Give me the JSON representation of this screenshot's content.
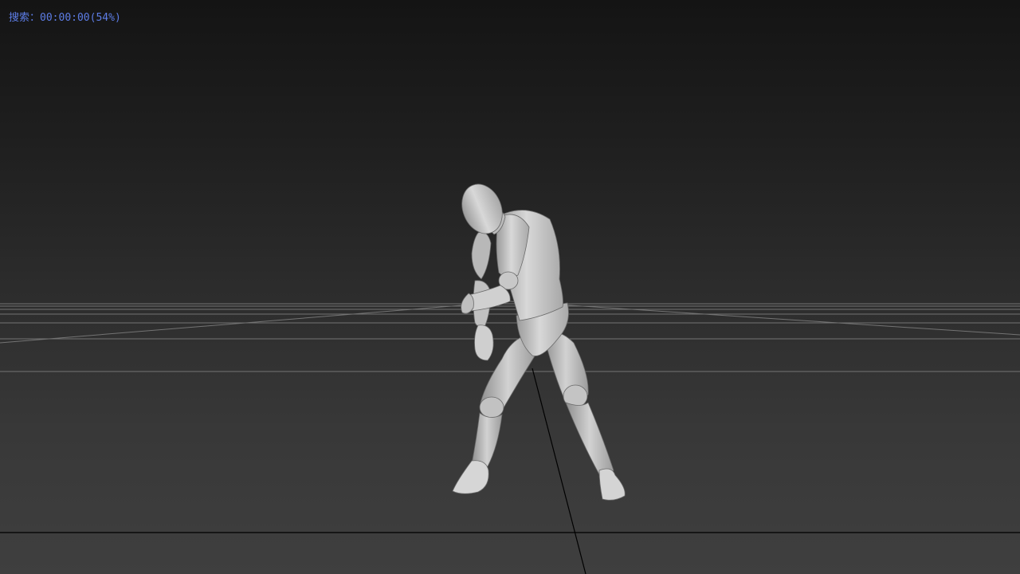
{
  "viewport": {
    "status_label": "搜索：",
    "status_time": "00:00:00",
    "status_percent": "(54%)"
  },
  "colors": {
    "status_text": "#5d7de6",
    "grid_line": "#8a8a8a",
    "mannequin": "#cfcfcf"
  },
  "scene": {
    "object": "mannequin"
  }
}
